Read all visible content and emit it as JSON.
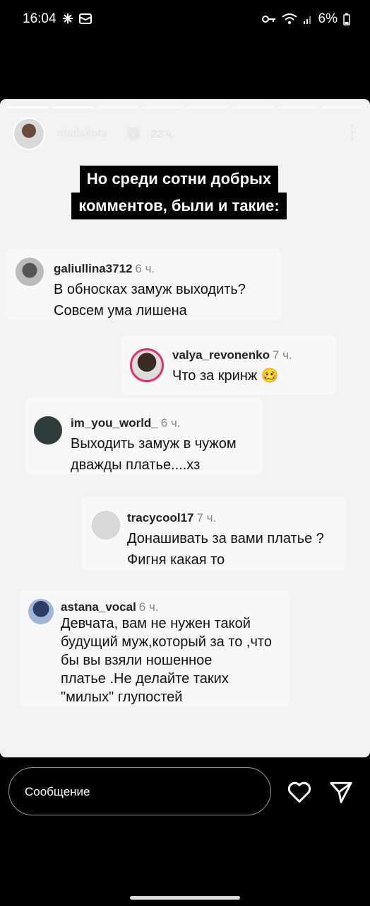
{
  "status_bar": {
    "time": "16:04",
    "battery": "6%"
  },
  "story": {
    "username": "ritadakota",
    "time_ago": "22 ч.",
    "headline_lines": [
      "Но среди сотни добрых",
      "комментов, были и такие:"
    ],
    "progress_segments": 8,
    "progress_done": 2
  },
  "comments": [
    {
      "user": "galiullina3712",
      "ago": "6 ч.",
      "text": "В обносках замуж выходить?\nСовсем ума лишена"
    },
    {
      "user": "valya_revonenko",
      "ago": "7 ч.",
      "text": "Что за кринж 🥴"
    },
    {
      "user": "im_you_world_",
      "ago": "6 ч.",
      "text": "Выходить замуж в чужом\nдважды платье....хз"
    },
    {
      "user": "tracycool17",
      "ago": "7 ч.",
      "text": "Донашивать за вами платье ?\nФигня какая то"
    },
    {
      "user": "astana_vocal",
      "ago": "6 ч.",
      "text": "Девчата, вам не нужен такой\nбудущий муж,который за то ,что\nбы вы взяли ношенное\nплатье .Не  делайте таких\n\"милых\" глупостей"
    }
  ],
  "bottom": {
    "message_placeholder": "Сообщение"
  },
  "icons": {
    "status_left": [
      "fan-icon",
      "mail-icon"
    ],
    "status_right": [
      "key-icon",
      "wifi-icon",
      "signal-icon",
      "battery-icon"
    ],
    "actions": [
      "heart-icon",
      "send-icon"
    ]
  }
}
